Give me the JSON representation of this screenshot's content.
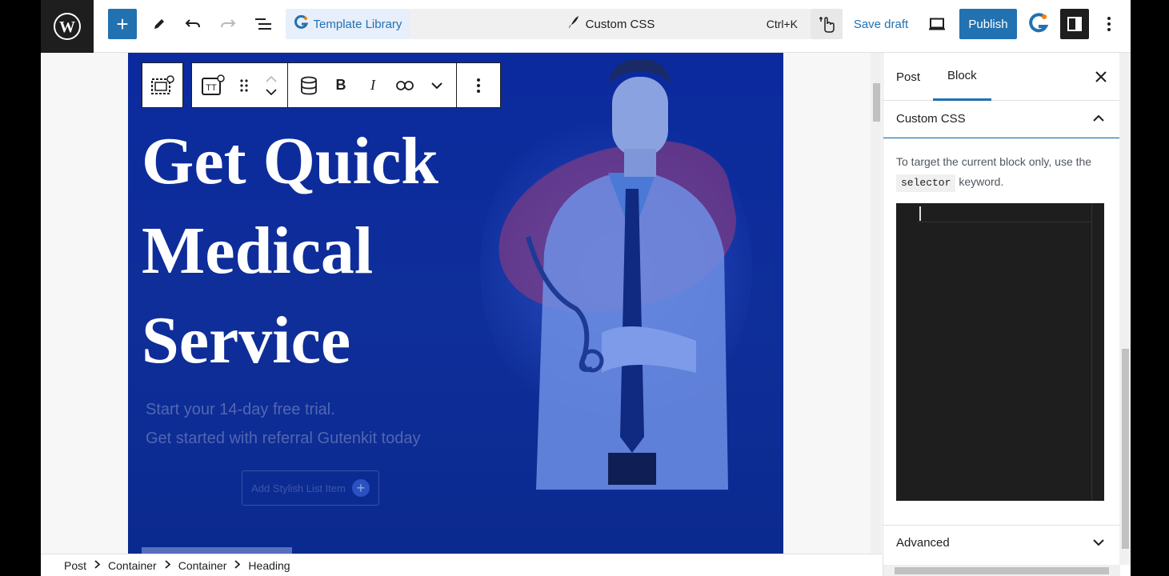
{
  "topbar": {
    "template_library_label": "Template Library",
    "command_label": "Custom CSS",
    "command_shortcut": "Ctrl+K",
    "save_draft_label": "Save draft",
    "publish_label": "Publish"
  },
  "hero": {
    "heading_lines": [
      "Get Quick",
      "Medical",
      "Service"
    ],
    "subtitle_lines": [
      "Start your 14-day free trial.",
      "Get started with referral Gutenkit today"
    ],
    "button_label": "Add Stylish List Item"
  },
  "sidebar": {
    "tabs": [
      {
        "label": "Post"
      },
      {
        "label": "Block"
      }
    ],
    "custom_css_title": "Custom CSS",
    "help_before": "To target the current block only, use the",
    "help_keyword": "selector",
    "help_after": "keyword.",
    "advanced_title": "Advanced"
  },
  "breadcrumb": [
    "Post",
    "Container",
    "Container",
    "Heading"
  ],
  "colors": {
    "accent": "#2271b1",
    "hero_bg": "#0b2a9e",
    "dark": "#1e1e1e"
  }
}
